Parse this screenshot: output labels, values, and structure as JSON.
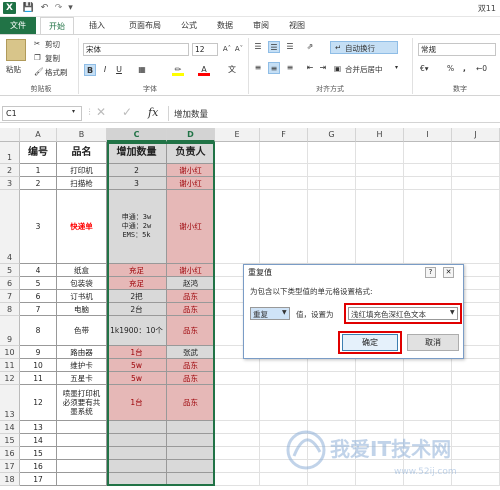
{
  "titlebar": {
    "doc_title": "双11"
  },
  "tabs": [
    "文件",
    "开始",
    "插入",
    "页面布局",
    "公式",
    "数据",
    "审阅",
    "视图"
  ],
  "ribbon": {
    "clipboard": {
      "paste": "粘贴",
      "cut": "剪切",
      "copy": "复制",
      "format_painter": "格式刷",
      "label": "剪贴板"
    },
    "font": {
      "name": "宋体",
      "size": "12",
      "label": "字体"
    },
    "alignment": {
      "wrap": "自动换行",
      "merge": "合并后居中",
      "label": "对齐方式"
    },
    "number": {
      "format": "常规",
      "label": "数字",
      "percent": "%",
      "comma": ","
    }
  },
  "formula": {
    "namebox": "C1",
    "fx": "fx",
    "value": "增加数量"
  },
  "columns": [
    "A",
    "B",
    "C",
    "D",
    "E",
    "F",
    "G",
    "H",
    "I",
    "J"
  ],
  "rows": [
    {
      "n": "1",
      "a": "编号",
      "b": "品名",
      "c": "增加数量",
      "d": "负责人"
    },
    {
      "n": "2",
      "a": "1",
      "b": "打印机",
      "c": "2",
      "d": "谢小红"
    },
    {
      "n": "3",
      "a": "2",
      "b": "扫描枪",
      "c": "3",
      "d": "谢小红"
    },
    {
      "n": "4",
      "a": "3",
      "b": "快递单",
      "c": "申通：3w\n中通：2w\nEMS：5k",
      "d": "谢小红"
    },
    {
      "n": "5",
      "a": "4",
      "b": "纸盒",
      "c": "充足",
      "d": "谢小红"
    },
    {
      "n": "6",
      "a": "5",
      "b": "包装袋",
      "c": "充足",
      "d": "赵鸿"
    },
    {
      "n": "7",
      "a": "6",
      "b": "订书机",
      "c": "2把",
      "d": "品东"
    },
    {
      "n": "8",
      "a": "7",
      "b": "电脑",
      "c": "2台",
      "d": "品东"
    },
    {
      "n": "9",
      "a": "8",
      "b": "色带",
      "c": "1k1900：10个",
      "d": "品东"
    },
    {
      "n": "10",
      "a": "9",
      "b": "路由器",
      "c": "1台",
      "d": "张武"
    },
    {
      "n": "11",
      "a": "10",
      "b": "维护卡",
      "c": "5w",
      "d": "品东"
    },
    {
      "n": "12",
      "a": "11",
      "b": "五星卡",
      "c": "5w",
      "d": "品东"
    },
    {
      "n": "13",
      "a": "12",
      "b": "喷墨打印机\n必须要有共\n墨系统",
      "c": "1台",
      "d": "品东"
    },
    {
      "n": "14",
      "a": "13",
      "b": "",
      "c": "",
      "d": ""
    },
    {
      "n": "15",
      "a": "14",
      "b": "",
      "c": "",
      "d": ""
    },
    {
      "n": "16",
      "a": "15",
      "b": "",
      "c": "",
      "d": ""
    },
    {
      "n": "17",
      "a": "16",
      "b": "",
      "c": "",
      "d": ""
    },
    {
      "n": "18",
      "a": "17",
      "b": "",
      "c": "",
      "d": ""
    }
  ],
  "dialog": {
    "title": "重复值",
    "prompt": "为包含以下类型值的单元格设置格式:",
    "type": "重复",
    "mid": "值，设置为",
    "format": "浅红填充色深红色文本",
    "ok": "确定",
    "cancel": "取消"
  },
  "watermark": {
    "text": "我爱IT技术网",
    "url": "www.52ij.com"
  },
  "colors": {
    "accent": "#217346",
    "highlight": "#e6b8b7",
    "dark_red": "#9c0006",
    "selection": "#d9d9d9"
  }
}
